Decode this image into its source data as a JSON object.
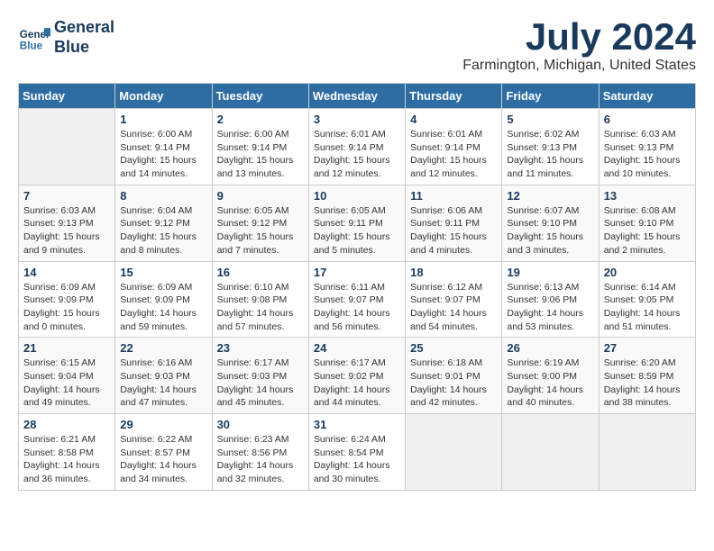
{
  "header": {
    "logo_line1": "General",
    "logo_line2": "Blue",
    "month_year": "July 2024",
    "location": "Farmington, Michigan, United States"
  },
  "days_of_week": [
    "Sunday",
    "Monday",
    "Tuesday",
    "Wednesday",
    "Thursday",
    "Friday",
    "Saturday"
  ],
  "weeks": [
    [
      {
        "day": "",
        "info": ""
      },
      {
        "day": "1",
        "info": "Sunrise: 6:00 AM\nSunset: 9:14 PM\nDaylight: 15 hours\nand 14 minutes."
      },
      {
        "day": "2",
        "info": "Sunrise: 6:00 AM\nSunset: 9:14 PM\nDaylight: 15 hours\nand 13 minutes."
      },
      {
        "day": "3",
        "info": "Sunrise: 6:01 AM\nSunset: 9:14 PM\nDaylight: 15 hours\nand 12 minutes."
      },
      {
        "day": "4",
        "info": "Sunrise: 6:01 AM\nSunset: 9:14 PM\nDaylight: 15 hours\nand 12 minutes."
      },
      {
        "day": "5",
        "info": "Sunrise: 6:02 AM\nSunset: 9:13 PM\nDaylight: 15 hours\nand 11 minutes."
      },
      {
        "day": "6",
        "info": "Sunrise: 6:03 AM\nSunset: 9:13 PM\nDaylight: 15 hours\nand 10 minutes."
      }
    ],
    [
      {
        "day": "7",
        "info": "Sunrise: 6:03 AM\nSunset: 9:13 PM\nDaylight: 15 hours\nand 9 minutes."
      },
      {
        "day": "8",
        "info": "Sunrise: 6:04 AM\nSunset: 9:12 PM\nDaylight: 15 hours\nand 8 minutes."
      },
      {
        "day": "9",
        "info": "Sunrise: 6:05 AM\nSunset: 9:12 PM\nDaylight: 15 hours\nand 7 minutes."
      },
      {
        "day": "10",
        "info": "Sunrise: 6:05 AM\nSunset: 9:11 PM\nDaylight: 15 hours\nand 5 minutes."
      },
      {
        "day": "11",
        "info": "Sunrise: 6:06 AM\nSunset: 9:11 PM\nDaylight: 15 hours\nand 4 minutes."
      },
      {
        "day": "12",
        "info": "Sunrise: 6:07 AM\nSunset: 9:10 PM\nDaylight: 15 hours\nand 3 minutes."
      },
      {
        "day": "13",
        "info": "Sunrise: 6:08 AM\nSunset: 9:10 PM\nDaylight: 15 hours\nand 2 minutes."
      }
    ],
    [
      {
        "day": "14",
        "info": "Sunrise: 6:09 AM\nSunset: 9:09 PM\nDaylight: 15 hours\nand 0 minutes."
      },
      {
        "day": "15",
        "info": "Sunrise: 6:09 AM\nSunset: 9:09 PM\nDaylight: 14 hours\nand 59 minutes."
      },
      {
        "day": "16",
        "info": "Sunrise: 6:10 AM\nSunset: 9:08 PM\nDaylight: 14 hours\nand 57 minutes."
      },
      {
        "day": "17",
        "info": "Sunrise: 6:11 AM\nSunset: 9:07 PM\nDaylight: 14 hours\nand 56 minutes."
      },
      {
        "day": "18",
        "info": "Sunrise: 6:12 AM\nSunset: 9:07 PM\nDaylight: 14 hours\nand 54 minutes."
      },
      {
        "day": "19",
        "info": "Sunrise: 6:13 AM\nSunset: 9:06 PM\nDaylight: 14 hours\nand 53 minutes."
      },
      {
        "day": "20",
        "info": "Sunrise: 6:14 AM\nSunset: 9:05 PM\nDaylight: 14 hours\nand 51 minutes."
      }
    ],
    [
      {
        "day": "21",
        "info": "Sunrise: 6:15 AM\nSunset: 9:04 PM\nDaylight: 14 hours\nand 49 minutes."
      },
      {
        "day": "22",
        "info": "Sunrise: 6:16 AM\nSunset: 9:03 PM\nDaylight: 14 hours\nand 47 minutes."
      },
      {
        "day": "23",
        "info": "Sunrise: 6:17 AM\nSunset: 9:03 PM\nDaylight: 14 hours\nand 45 minutes."
      },
      {
        "day": "24",
        "info": "Sunrise: 6:17 AM\nSunset: 9:02 PM\nDaylight: 14 hours\nand 44 minutes."
      },
      {
        "day": "25",
        "info": "Sunrise: 6:18 AM\nSunset: 9:01 PM\nDaylight: 14 hours\nand 42 minutes."
      },
      {
        "day": "26",
        "info": "Sunrise: 6:19 AM\nSunset: 9:00 PM\nDaylight: 14 hours\nand 40 minutes."
      },
      {
        "day": "27",
        "info": "Sunrise: 6:20 AM\nSunset: 8:59 PM\nDaylight: 14 hours\nand 38 minutes."
      }
    ],
    [
      {
        "day": "28",
        "info": "Sunrise: 6:21 AM\nSunset: 8:58 PM\nDaylight: 14 hours\nand 36 minutes."
      },
      {
        "day": "29",
        "info": "Sunrise: 6:22 AM\nSunset: 8:57 PM\nDaylight: 14 hours\nand 34 minutes."
      },
      {
        "day": "30",
        "info": "Sunrise: 6:23 AM\nSunset: 8:56 PM\nDaylight: 14 hours\nand 32 minutes."
      },
      {
        "day": "31",
        "info": "Sunrise: 6:24 AM\nSunset: 8:54 PM\nDaylight: 14 hours\nand 30 minutes."
      },
      {
        "day": "",
        "info": ""
      },
      {
        "day": "",
        "info": ""
      },
      {
        "day": "",
        "info": ""
      }
    ]
  ]
}
